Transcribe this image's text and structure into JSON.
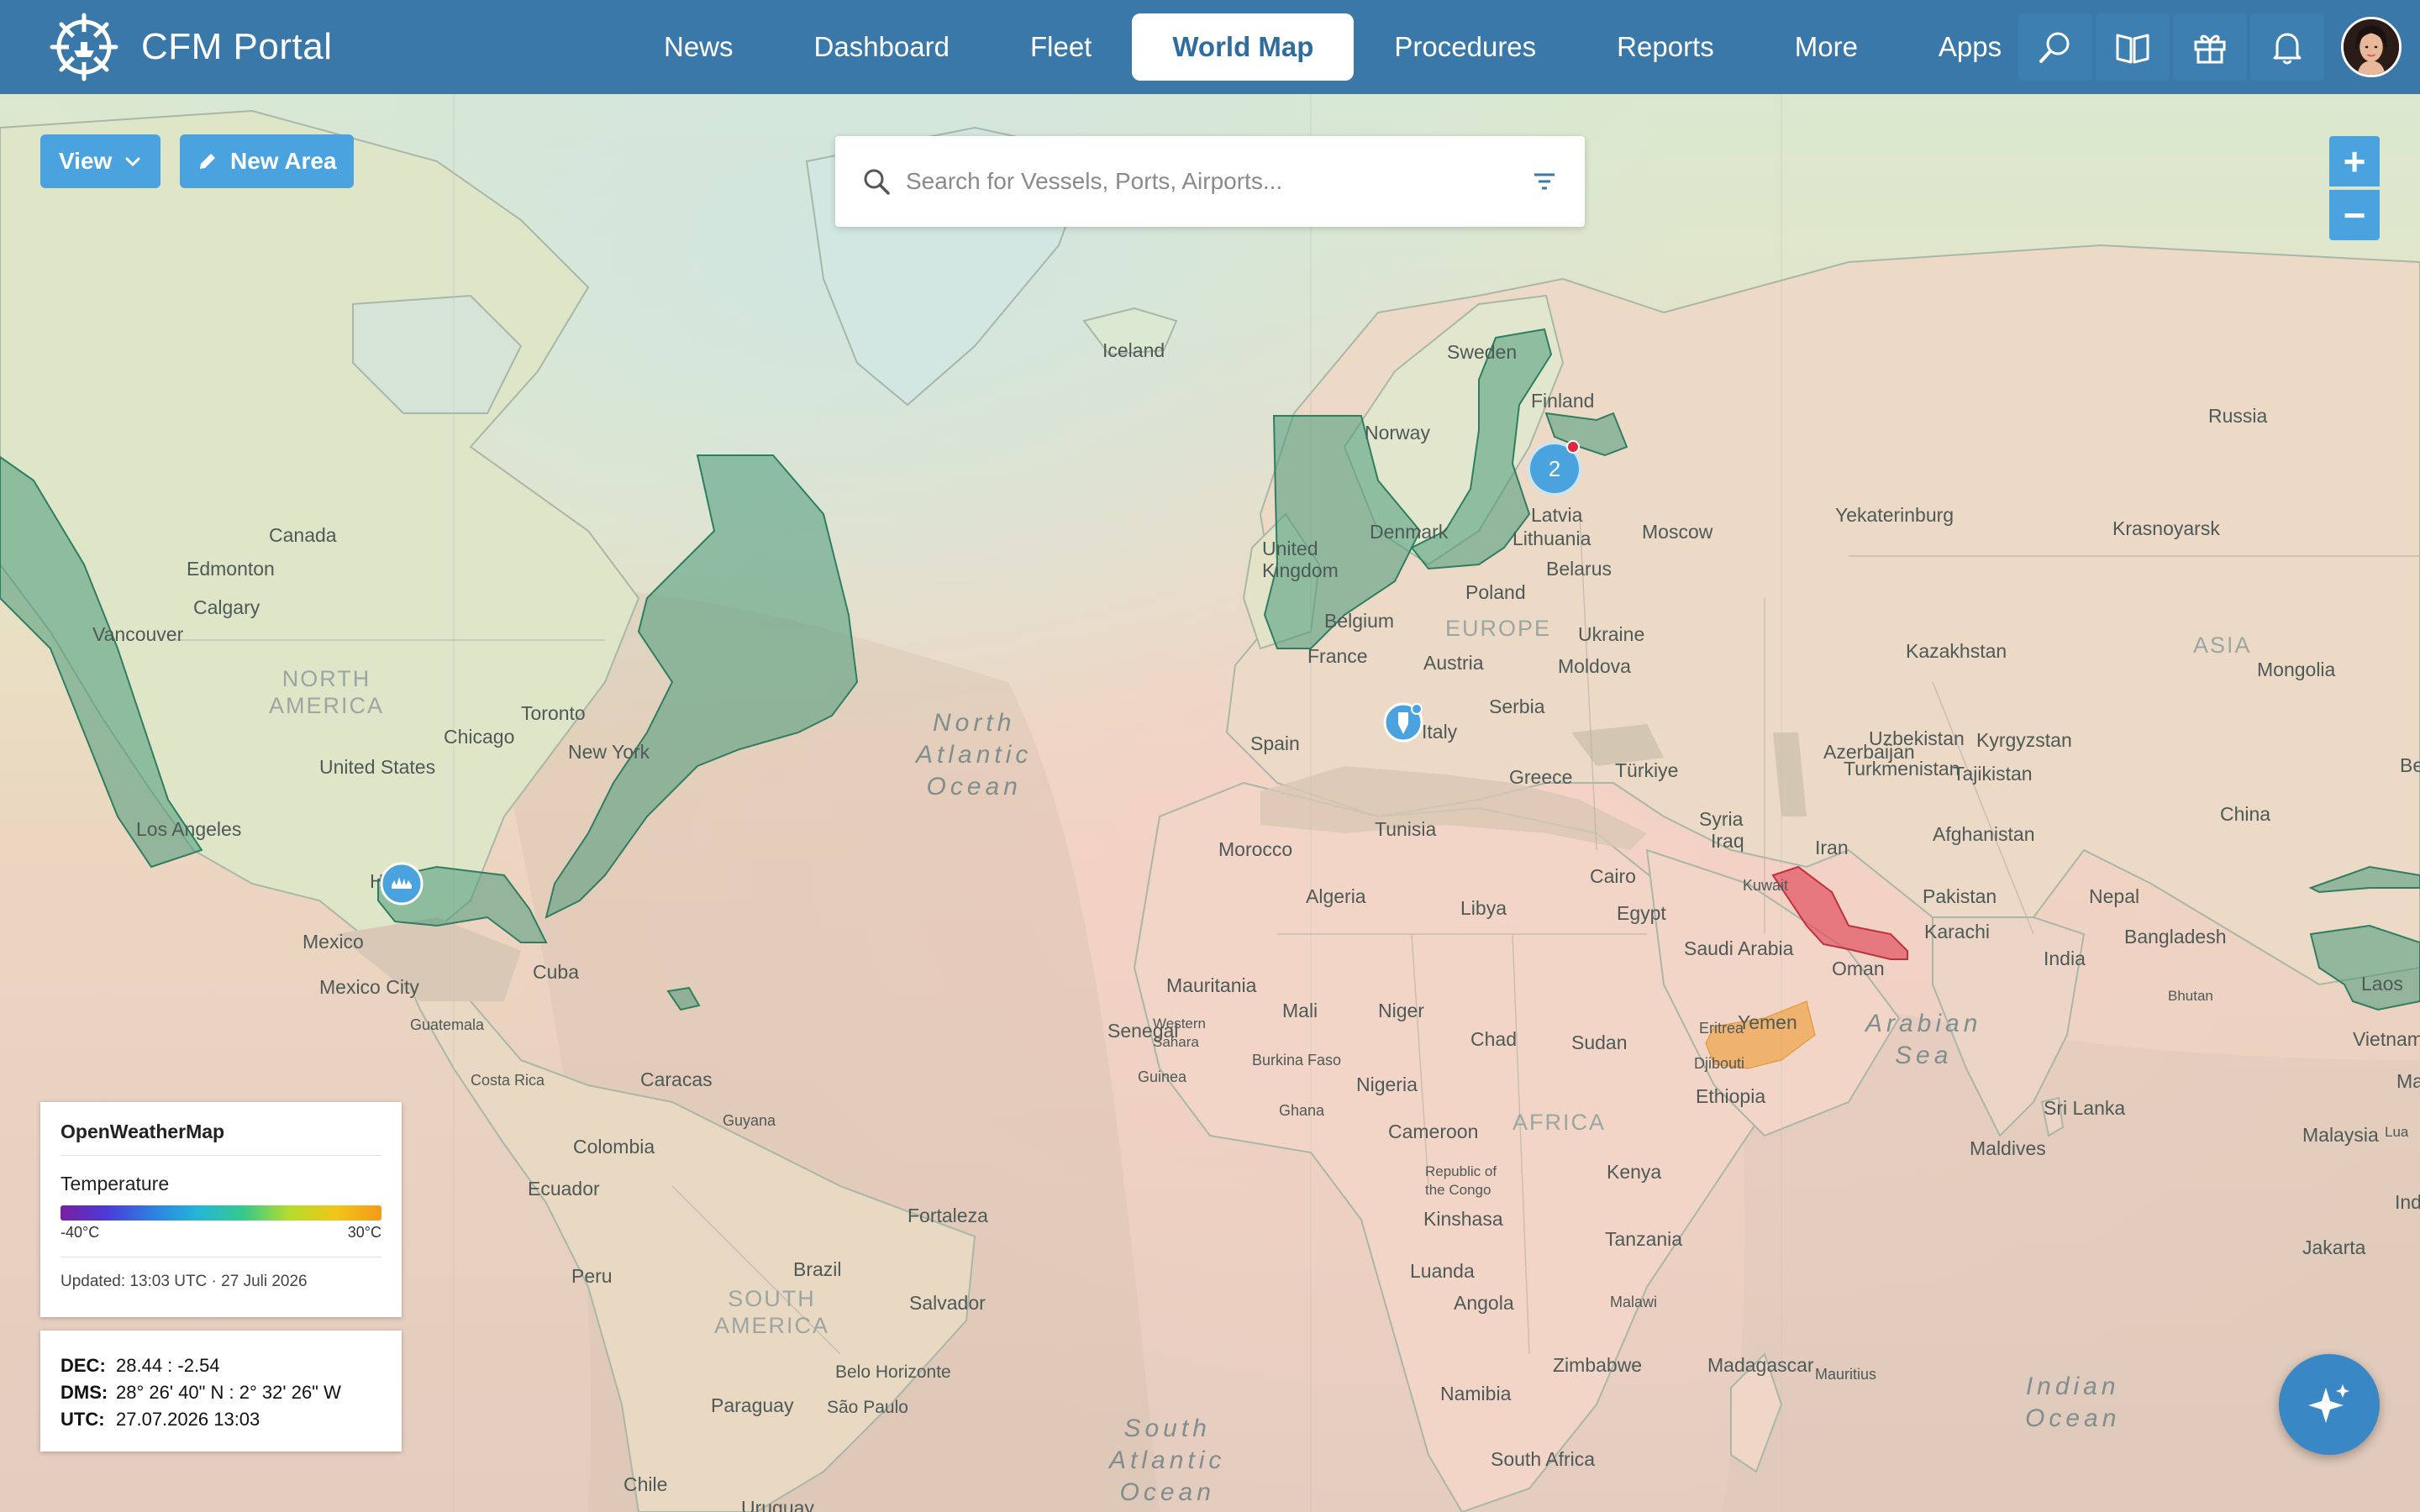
{
  "app": {
    "title": "CFM Portal"
  },
  "nav": {
    "items": [
      {
        "label": "News",
        "active": false
      },
      {
        "label": "Dashboard",
        "active": false
      },
      {
        "label": "Fleet",
        "active": false
      },
      {
        "label": "World Map",
        "active": true
      },
      {
        "label": "Procedures",
        "active": false
      },
      {
        "label": "Reports",
        "active": false
      },
      {
        "label": "More",
        "active": false
      },
      {
        "label": "Apps",
        "active": false
      }
    ],
    "icons": [
      "search-icon",
      "book-icon",
      "gift-icon",
      "bell-icon"
    ]
  },
  "toolbar": {
    "view_label": "View",
    "new_area_label": "New Area"
  },
  "search": {
    "placeholder": "Search for Vessels, Ports, Airports..."
  },
  "zoom": {
    "in": "+",
    "out": "−"
  },
  "map": {
    "ocean_labels": [
      "North\nAtlantic\nOcean",
      "Arabian\nSea",
      "Indian\nOcean",
      "South\nAtlantic\nOcean"
    ],
    "continent_labels": [
      "NORTH\nAMERICA",
      "EUROPE",
      "AFRICA",
      "SOUTH\nAMERICA",
      "ASIA"
    ],
    "labels": [
      "Iceland",
      "Sweden",
      "Finland",
      "Norway",
      "Russia",
      "Canada",
      "Edmonton",
      "Calgary",
      "Vancouver",
      "Yekaterinburg",
      "Krasnoyarsk",
      "United Kingdom",
      "Denmark",
      "Latvia",
      "Lithuania",
      "Moscow",
      "Belarus",
      "Poland",
      "Belgium",
      "France",
      "Austria",
      "Ukraine",
      "Moldova",
      "Kazakhstan",
      "Mongolia",
      "Chicago",
      "Toronto",
      "New York",
      "United States",
      "Los Angeles",
      "Spain",
      "Italy",
      "Serbia",
      "Azerbaijan",
      "Uzbekistan",
      "Kyrgyzstan",
      "Turkmenistan",
      "Tajikistan",
      "Greece",
      "Türkiye",
      "Syria",
      "Iraq",
      "Iran",
      "Afghanistan",
      "China",
      "Morocco",
      "Tunisia",
      "Kuwait",
      "Pakistan",
      "Nepal",
      "Algeria",
      "Libya",
      "Cairo",
      "Egypt",
      "Saudi Arabia",
      "Oman",
      "Karachi",
      "Bangladesh",
      "India",
      "Mexico",
      "Cuba",
      "Western Sahara",
      "Mauritania",
      "Mali",
      "Niger",
      "Chad",
      "Sudan",
      "Eritrea",
      "Yemen",
      "Djibouti",
      "Ethiopia",
      "Mexico City",
      "Guatemala",
      "Senegal",
      "Guinea",
      "Burkina Faso",
      "Nigeria",
      "Ghana",
      "Costa Rica",
      "Caracas",
      "Guyana",
      "Cameroon",
      "Kenya",
      "Republic of the Congo",
      "Kinshasa",
      "Tanzania",
      "Colombia",
      "Ecuador",
      "Peru",
      "Brazil",
      "Fortaleza",
      "Salvador",
      "Luanda",
      "Angola",
      "Malawi",
      "Zimbabwe",
      "Madagascar",
      "Mauritius",
      "Namibia",
      "Belo Horizonte",
      "São Paulo",
      "Paraguay",
      "Chile",
      "Uruguay",
      "South Africa",
      "Laos",
      "Vietnam",
      "Sri Lanka",
      "Maldives",
      "Malaysia",
      "Jakarta",
      "Bhutan",
      "Be",
      "Ho",
      "Lua",
      "Ind",
      "Ma"
    ],
    "cluster_count": "2"
  },
  "legend": {
    "title": "OpenWeatherMap",
    "layer": "Temperature",
    "min_label": "-40°C",
    "max_label": "30°C",
    "updated": "Updated: 13:03 UTC · 27 Juli 2026"
  },
  "coords": {
    "dec_label": "DEC:",
    "dec_value": "28.44 : -2.54",
    "dms_label": "DMS:",
    "dms_value": "28° 26' 40\" N : 2° 32' 26\" W",
    "utc_label": "UTC:",
    "utc_value": "27.07.2026 13:03"
  },
  "colors": {
    "nav_bg": "#3a78a9",
    "accent": "#4aa3de",
    "area_green": "#4a9b7c",
    "area_red": "#e0485c",
    "area_orange": "#f0a44a"
  }
}
